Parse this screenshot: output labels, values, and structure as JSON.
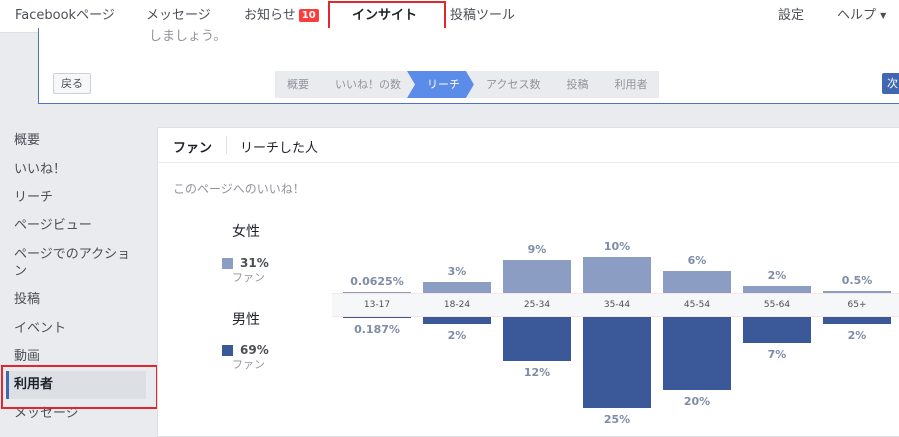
{
  "nav": {
    "items": [
      "Facebookページ",
      "メッセージ",
      "お知らせ",
      "インサイト",
      "投稿ツール"
    ],
    "notifications_badge": "10",
    "right_items": [
      "設定",
      "ヘルプ"
    ],
    "help_caret": "▼"
  },
  "guide": {
    "partial_text": "しましょう。",
    "back_label": "戻る",
    "next_label": "次",
    "steps": [
      "概要",
      "いいね！の数",
      "リーチ",
      "アクセス数",
      "投稿",
      "利用者"
    ]
  },
  "sidebar": {
    "items": [
      "概要",
      "いいね！",
      "リーチ",
      "ページビュー",
      "ページでのアクション",
      "投稿",
      "イベント",
      "動画",
      "利用者",
      "メッセージ"
    ]
  },
  "main": {
    "tabs": [
      "ファン",
      "リーチした人"
    ],
    "section_title": "このページへのいいね！"
  },
  "legend": {
    "female_label": "女性",
    "female_pct": "31%",
    "female_sub": "ファン",
    "male_label": "男性",
    "male_pct": "69%",
    "male_sub": "ファン"
  },
  "colors": {
    "female": "#8b9dc3",
    "male": "#3b5998",
    "accent": "#4267b2",
    "highlight_box": "#e0262e"
  },
  "chart_data": {
    "type": "bar",
    "categories": [
      "13-17",
      "18-24",
      "25-34",
      "35-44",
      "45-54",
      "55-64",
      "65+"
    ],
    "series": [
      {
        "name": "女性",
        "values": [
          0.0625,
          3,
          9,
          10,
          6,
          2,
          0.5
        ],
        "labels": [
          "0.0625%",
          "3%",
          "9%",
          "10%",
          "6%",
          "2%",
          "0.5%"
        ]
      },
      {
        "name": "男性",
        "values": [
          0.187,
          2,
          12,
          25,
          20,
          7,
          2
        ],
        "labels": [
          "0.187%",
          "2%",
          "12%",
          "25%",
          "20%",
          "7%",
          "2%"
        ]
      }
    ]
  }
}
